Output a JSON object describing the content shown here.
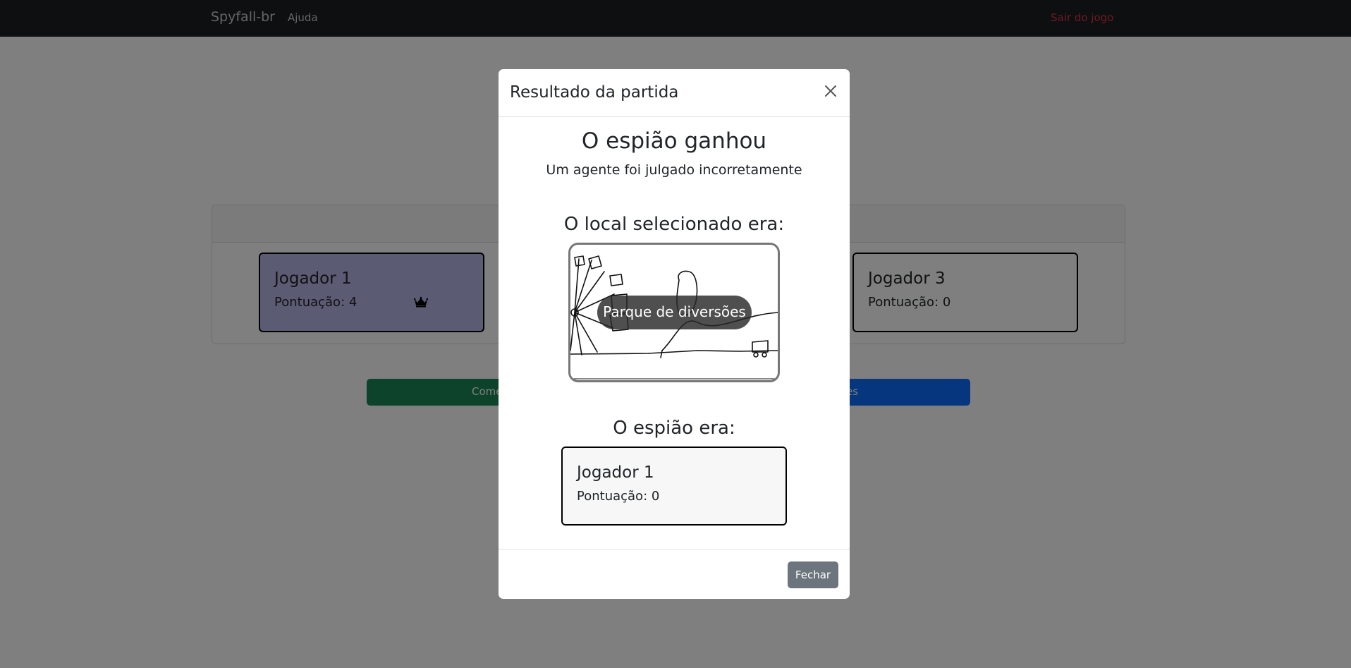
{
  "navbar": {
    "brand": "Spyfall-br",
    "help": "Ajuda",
    "exit": "Sair do jogo"
  },
  "players": [
    {
      "name": "Jogador 1",
      "score": "Pontuação: 4",
      "is_host": true,
      "bg": "#b7b7e6"
    },
    {
      "name": "Jogador 3",
      "score": "Pontuação: 0",
      "is_host": false,
      "bg": "#ffffff"
    }
  ],
  "buttons": {
    "start": "Come",
    "settings": "es"
  },
  "modal": {
    "title": "Resultado da partida",
    "result_title": "O espião ganhou",
    "result_reason": "Um agente foi julgado incorretamente",
    "location_heading": "O local selecionado era:",
    "location_name": "Parque de diversões",
    "spy_heading": "O espião era:",
    "spy": {
      "name": "Jogador 1",
      "score": "Pontuação: 0"
    },
    "close_button": "Fechar"
  },
  "colors": {
    "navbar": "#1b1e22",
    "exit_link": "#dc3545",
    "start_button": "#198754",
    "settings_button": "#0d6efd",
    "close_button": "#6c757d"
  }
}
